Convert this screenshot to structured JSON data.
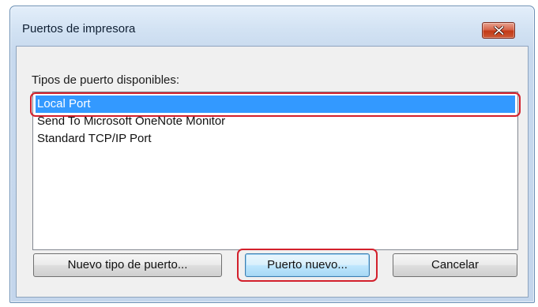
{
  "window": {
    "title": "Puertos de impresora",
    "close_icon": "close-icon"
  },
  "list": {
    "label": "Tipos de puerto disponibles:",
    "items": [
      {
        "label": "Local Port",
        "selected": true
      },
      {
        "label": "Send To Microsoft OneNote Monitor",
        "selected": false
      },
      {
        "label": "Standard TCP/IP Port",
        "selected": false
      }
    ]
  },
  "buttons": {
    "new_port_type": "Nuevo tipo de puerto...",
    "new_port": "Puerto nuevo...",
    "cancel": "Cancelar"
  },
  "colors": {
    "selection": "#3399ff",
    "highlight_annotation": "#d3202c"
  }
}
